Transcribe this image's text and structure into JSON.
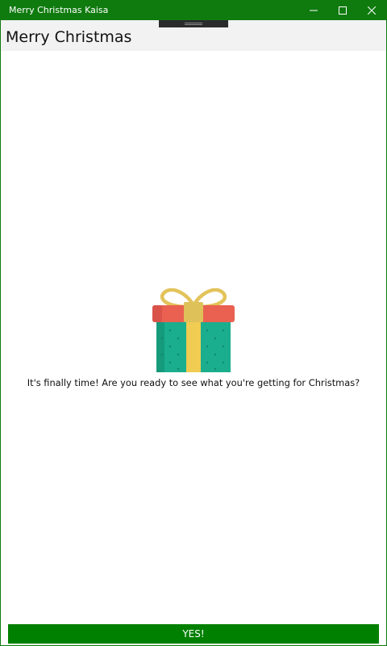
{
  "window": {
    "title": "Merry Christmas Kaisa",
    "controls": {
      "minimize_icon": "minimize-icon",
      "maximize_icon": "maximize-icon",
      "close_icon": "close-icon"
    }
  },
  "header": {
    "title": "Merry Christmas"
  },
  "main": {
    "image_icon": "gift-box-icon",
    "message": "It's finally time! Are you ready to see what you're getting for Christmas?"
  },
  "footer": {
    "button_label": "YES!"
  },
  "colors": {
    "titlebar": "#0f7b0f",
    "button": "#008000",
    "gift_box": "#1aae8e",
    "gift_lid": "#ea6152",
    "ribbon": "#edc94f"
  }
}
